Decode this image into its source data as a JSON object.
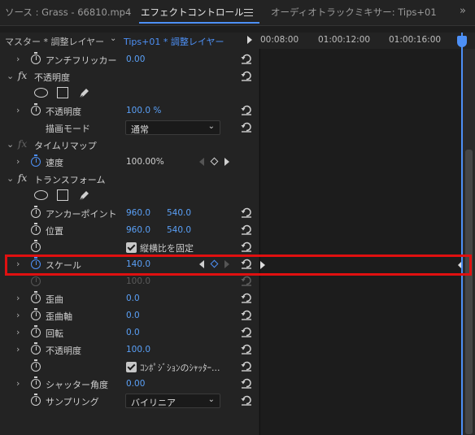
{
  "tabs": [
    {
      "label": "ソース : Grass - 66810.mp4",
      "active": false
    },
    {
      "label": "エフェクトコントロール",
      "active": true
    },
    {
      "label": "オーディオトラックミキサー: Tips+01",
      "active": false
    }
  ],
  "tab_more": "»",
  "header": {
    "source": "マスター * 調整レイヤー",
    "clip": "Tips+01 * 調整レイヤー",
    "ruler": [
      "00:08:00",
      "01:00:12:00",
      "01:00:16:00"
    ]
  },
  "rows": {
    "antiflicker": {
      "label": "アンチフリッカー",
      "value": "0.00"
    },
    "opacity_fx": {
      "label": "不透明度"
    },
    "opacity": {
      "label": "不透明度",
      "value": "100.0 %"
    },
    "blend_mode": {
      "label": "描画モード",
      "value": "通常"
    },
    "timeremap_fx": {
      "label": "タイムリマップ"
    },
    "speed": {
      "label": "速度",
      "value": "100.00%"
    },
    "transform_fx": {
      "label": "トランスフォーム"
    },
    "anchor": {
      "label": "アンカーポイント",
      "x": "960.0",
      "y": "540.0"
    },
    "position": {
      "label": "位置",
      "x": "960.0",
      "y": "540.0"
    },
    "uniform_scale": {
      "label": "縦横比を固定",
      "checked": true
    },
    "scale": {
      "label": "スケール",
      "value": "140.0"
    },
    "scale_width": {
      "value": "100.0"
    },
    "skew": {
      "label": "歪曲",
      "value": "0.0"
    },
    "skew_axis": {
      "label": "歪曲軸",
      "value": "0.0"
    },
    "rotation": {
      "label": "回転",
      "value": "0.0"
    },
    "t_opacity": {
      "label": "不透明度",
      "value": "100.0"
    },
    "comp_shutter": {
      "label": "ｺﾝﾎﾟｼﾞｼｮﾝのｼｬｯﾀｰ...",
      "checked": true
    },
    "shutter_angle": {
      "label": "シャッター角度",
      "value": "0.00"
    },
    "sampling": {
      "label": "サンプリング",
      "value": "バイリニア"
    }
  },
  "colors": {
    "accent": "#4d90f6",
    "highlight": "#e01010",
    "panel": "#232323"
  }
}
